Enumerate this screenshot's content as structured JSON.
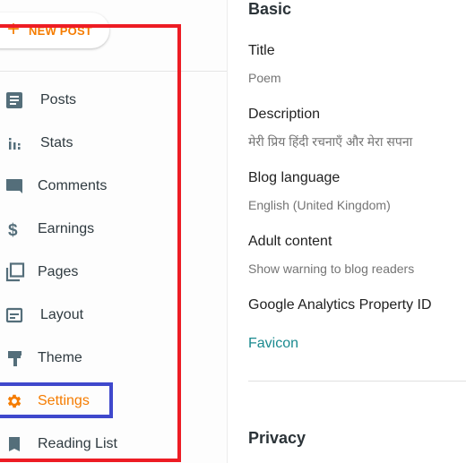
{
  "sidebar": {
    "new_post": {
      "icon": "plus-icon",
      "label": "NEW POST"
    },
    "items": [
      {
        "label": "Posts",
        "icon": "posts-icon",
        "active": false
      },
      {
        "label": "Stats",
        "icon": "stats-icon",
        "active": false
      },
      {
        "label": "Comments",
        "icon": "comment-icon",
        "active": false
      },
      {
        "label": "Earnings",
        "icon": "dollar-icon",
        "active": false
      },
      {
        "label": "Pages",
        "icon": "pages-icon",
        "active": false
      },
      {
        "label": "Layout",
        "icon": "layout-icon",
        "active": false
      },
      {
        "label": "Theme",
        "icon": "paint-roller-icon",
        "active": false
      },
      {
        "label": "Settings",
        "icon": "gear-icon",
        "active": true
      },
      {
        "label": "Reading List",
        "icon": "bookmark-icon",
        "active": false
      }
    ]
  },
  "colors": {
    "accent": "#f57c00",
    "icon": "#546e7a",
    "link": "#1a8a8f",
    "annotation_red": "#ed1c24",
    "annotation_blue": "#3f48cc"
  },
  "content": {
    "basic": {
      "title": "Basic",
      "fields": [
        {
          "label": "Title",
          "value": "Poem"
        },
        {
          "label": "Description",
          "value": "मेरी प्रिय हिंदी रचनाएँ और मेरा सपना"
        },
        {
          "label": "Blog language",
          "value": "English (United Kingdom)"
        },
        {
          "label": "Adult content",
          "value": "Show warning to blog readers"
        },
        {
          "label": "Google Analytics Property ID"
        }
      ],
      "favicon_link": "Favicon"
    },
    "privacy": {
      "title": "Privacy"
    }
  }
}
